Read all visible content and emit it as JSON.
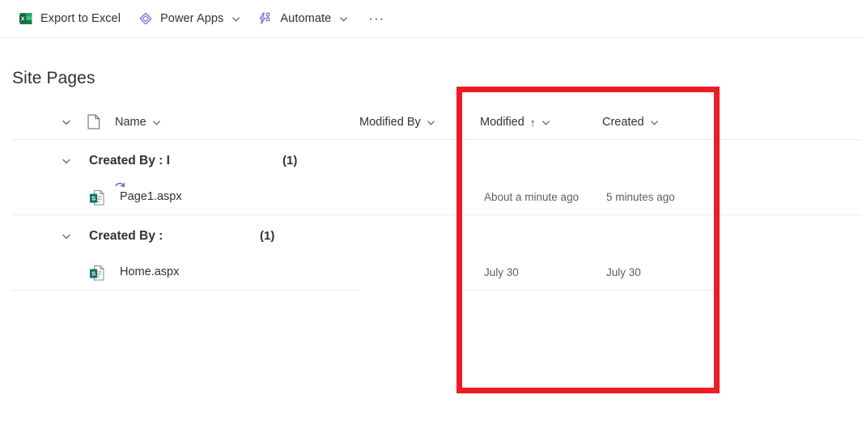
{
  "commandbar": {
    "buttons": [
      {
        "label": "Export to Excel",
        "icon": "excel-icon",
        "has_chevron": false
      },
      {
        "label": "Power Apps",
        "icon": "power-apps-icon",
        "has_chevron": true
      },
      {
        "label": "Automate",
        "icon": "power-automate-icon",
        "has_chevron": true
      }
    ],
    "overflow_label": "···"
  },
  "page": {
    "title": "Site Pages"
  },
  "columns": [
    {
      "label": "Name",
      "sorted": false,
      "sort_glyph": ""
    },
    {
      "label": "Modified By",
      "sorted": false,
      "sort_glyph": ""
    },
    {
      "label": "Modified",
      "sorted": true,
      "sort_glyph": "↑"
    },
    {
      "label": "Created",
      "sorted": false,
      "sort_glyph": ""
    }
  ],
  "groups": [
    {
      "title": "Created By : I",
      "count": "(1)",
      "items": [
        {
          "name": "Page1.aspx",
          "icon": "sharepoint-page-icon",
          "loading": true,
          "modified_by": "",
          "modified": "About a minute ago",
          "created": "5 minutes ago"
        }
      ]
    },
    {
      "title": "Created By :",
      "count": "(1)",
      "items": [
        {
          "name": "Home.aspx",
          "icon": "sharepoint-page-icon",
          "loading": false,
          "modified_by": "",
          "modified": "July 30",
          "created": "July 30"
        }
      ]
    }
  ],
  "annotation": {
    "color": "#ED1C24",
    "label": "date-columns-highlight"
  }
}
